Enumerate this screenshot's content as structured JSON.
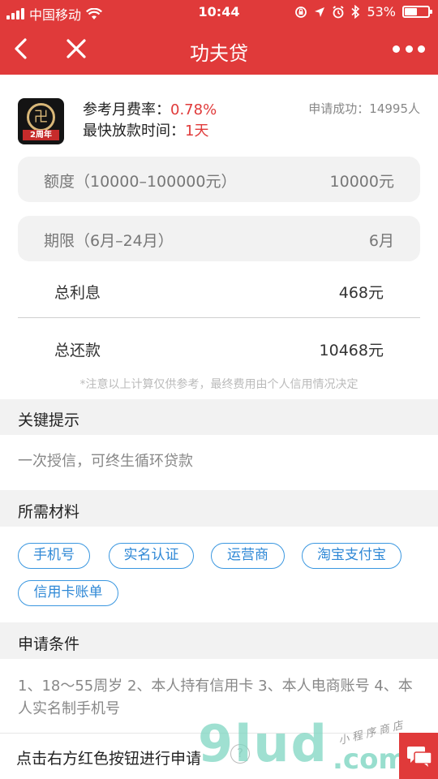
{
  "status_bar": {
    "carrier": "中国移动",
    "time": "10:44",
    "battery_percent": "53%",
    "battery_level": 0.53,
    "icons": [
      "signal-icon",
      "wifi-icon",
      "orientation-lock-icon",
      "location-icon",
      "alarm-icon",
      "bluetooth-icon",
      "battery-icon"
    ]
  },
  "nav": {
    "title": "功夫贷",
    "back_icon": "chevron-left-icon",
    "close_icon": "close-icon",
    "more_icon": "more-dots-icon"
  },
  "product": {
    "logo_text": "2周年",
    "rate_label": "参考月费率：",
    "rate_value": "0.78%",
    "time_label": "最快放款时间：",
    "time_value": "1天",
    "success_text": "申请成功：14995人"
  },
  "calculator": {
    "amount_label": "额度（10000–100000元）",
    "amount_value": "10000元",
    "term_label": "期限（6月–24月）",
    "term_value": "6月",
    "interest_label": "总利息",
    "interest_value": "468元",
    "repay_label": "总还款",
    "repay_value": "10468元",
    "note": "*注意以上计算仅供参考，最终费用由个人信用情况决定"
  },
  "tips": {
    "heading": "关键提示",
    "text": "一次授信，可终生循环贷款"
  },
  "materials": {
    "heading": "所需材料",
    "tags": [
      "手机号",
      "实名认证",
      "运营商",
      "淘宝支付宝",
      "信用卡账单"
    ]
  },
  "conditions": {
    "heading": "申请条件",
    "text": "1、18～55周岁 2、本人持有信用卡 3、本人电商账号 4、本人实名制手机号"
  },
  "bottom_bar": {
    "text": "点击右方红色按钮进行申请",
    "help_icon": "question-icon",
    "chat_icon": "chat-icon"
  },
  "watermark": {
    "big": "9lud",
    "com": ".com",
    "small": "小程序商店"
  },
  "colors": {
    "brand_red": "#e03a3a",
    "tag_blue": "#3a97e0",
    "watermark_teal": "#7fd6c2"
  }
}
